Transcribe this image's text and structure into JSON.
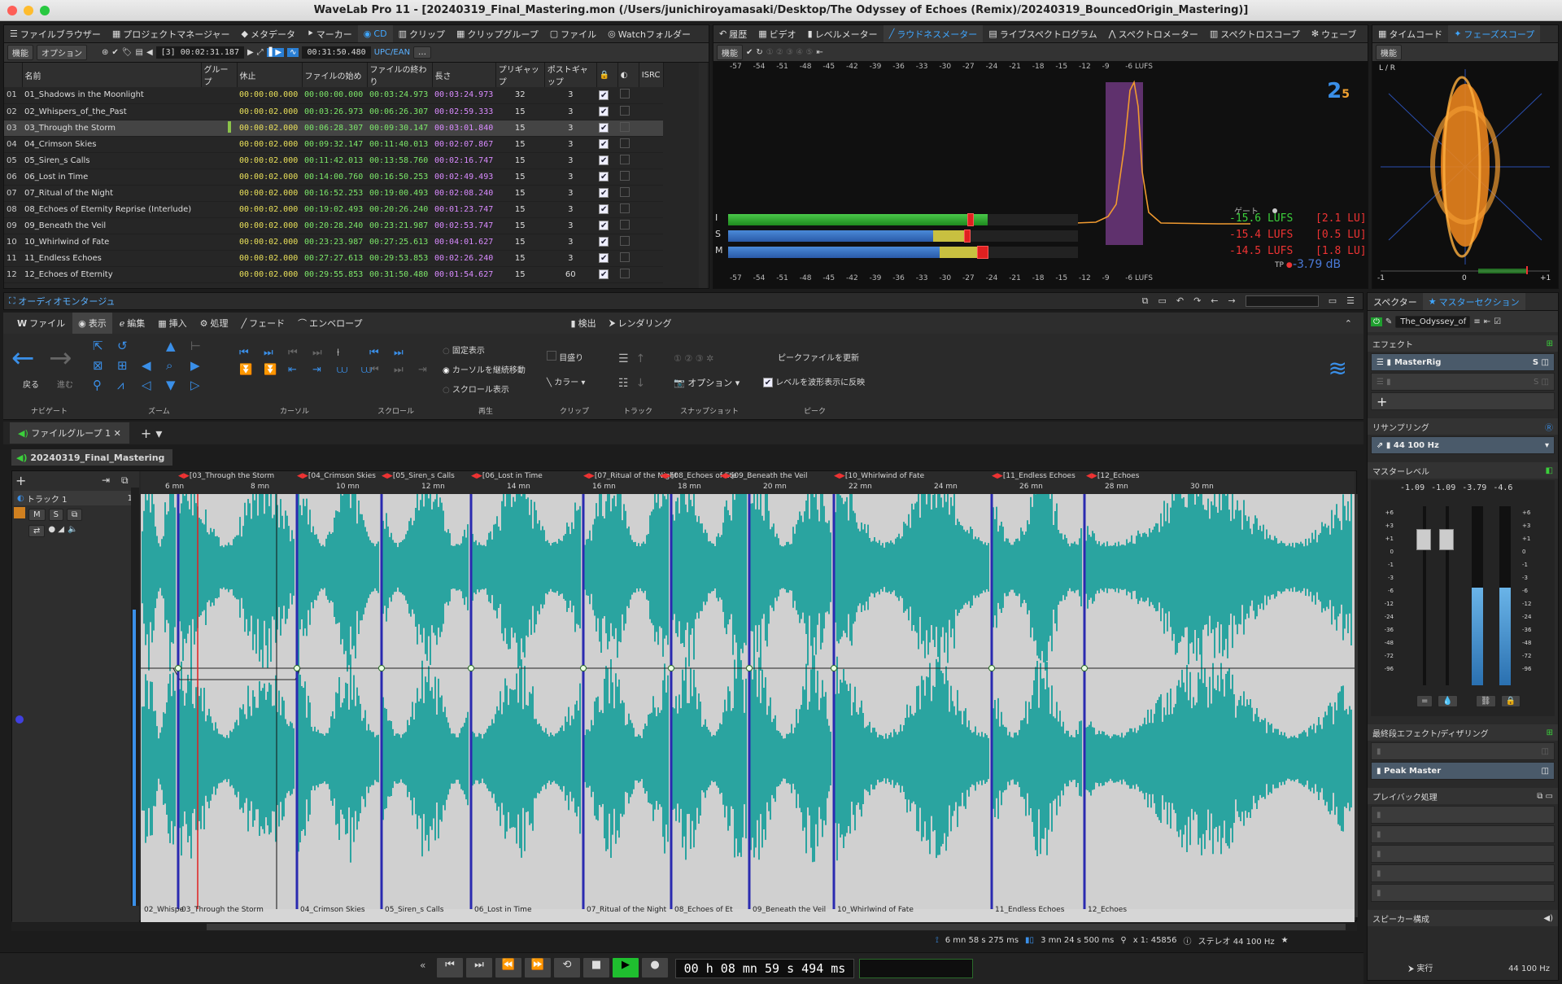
{
  "window": {
    "title": "WaveLab Pro 11 - [20240319_Final_Mastering.mon (/Users/junichiroyamasaki/Desktop/The Odyssey of Echoes (Remix)/20240319_BouncedOrigin_Mastering)]"
  },
  "top_left_tabs": [
    "ファイルブラウザー",
    "プロジェクトマネージャー",
    "メタデータ",
    "マーカー",
    "CD",
    "クリップ",
    "クリップグループ",
    "ファイル",
    "Watchフォルダー"
  ],
  "cd_toolbar": {
    "func": "機能",
    "option": "オプション",
    "track_pos": "[3] 00:02:31.187",
    "total": "00:31:50.480",
    "upc": "UPC/EAN"
  },
  "cd_columns": [
    "名前",
    "グループ",
    "休止",
    "ファイルの始め",
    "ファイルの終わり",
    "長さ",
    "プリギャップ",
    "ポストギャップ",
    "ISRC"
  ],
  "cd_tracks": [
    {
      "n": "01",
      "name": "01_Shadows in the Moonlight",
      "pause": "00:00:00.000",
      "start": "00:00:00.000",
      "end": "00:03:24.973",
      "len": "00:03:24.973",
      "pre": "32",
      "post": "3"
    },
    {
      "n": "02",
      "name": "02_Whispers_of_the_Past",
      "pause": "00:00:02.000",
      "start": "00:03:26.973",
      "end": "00:06:26.307",
      "len": "00:02:59.333",
      "pre": "15",
      "post": "3"
    },
    {
      "n": "03",
      "name": "03_Through the Storm",
      "pause": "00:00:02.000",
      "start": "00:06:28.307",
      "end": "00:09:30.147",
      "len": "00:03:01.840",
      "pre": "15",
      "post": "3"
    },
    {
      "n": "04",
      "name": "04_Crimson Skies",
      "pause": "00:00:02.000",
      "start": "00:09:32.147",
      "end": "00:11:40.013",
      "len": "00:02:07.867",
      "pre": "15",
      "post": "3"
    },
    {
      "n": "05",
      "name": "05_Siren_s Calls",
      "pause": "00:00:02.000",
      "start": "00:11:42.013",
      "end": "00:13:58.760",
      "len": "00:02:16.747",
      "pre": "15",
      "post": "3"
    },
    {
      "n": "06",
      "name": "06_Lost in Time",
      "pause": "00:00:02.000",
      "start": "00:14:00.760",
      "end": "00:16:50.253",
      "len": "00:02:49.493",
      "pre": "15",
      "post": "3"
    },
    {
      "n": "07",
      "name": "07_Ritual of the Night",
      "pause": "00:00:02.000",
      "start": "00:16:52.253",
      "end": "00:19:00.493",
      "len": "00:02:08.240",
      "pre": "15",
      "post": "3"
    },
    {
      "n": "08",
      "name": "08_Echoes of Eternity Reprise (Interlude)",
      "pause": "00:00:02.000",
      "start": "00:19:02.493",
      "end": "00:20:26.240",
      "len": "00:01:23.747",
      "pre": "15",
      "post": "3"
    },
    {
      "n": "09",
      "name": "09_Beneath the Veil",
      "pause": "00:00:02.000",
      "start": "00:20:28.240",
      "end": "00:23:21.987",
      "len": "00:02:53.747",
      "pre": "15",
      "post": "3"
    },
    {
      "n": "10",
      "name": "10_Whirlwind of Fate",
      "pause": "00:00:02.000",
      "start": "00:23:23.987",
      "end": "00:27:25.613",
      "len": "00:04:01.627",
      "pre": "15",
      "post": "3"
    },
    {
      "n": "11",
      "name": "11_Endless Echoes",
      "pause": "00:00:02.000",
      "start": "00:27:27.613",
      "end": "00:29:53.853",
      "len": "00:02:26.240",
      "pre": "15",
      "post": "3"
    },
    {
      "n": "12",
      "name": "12_Echoes of Eternity",
      "pause": "00:00:02.000",
      "start": "00:29:55.853",
      "end": "00:31:50.480",
      "len": "00:01:54.627",
      "pre": "15",
      "post": "60"
    }
  ],
  "meter_tabs": [
    "履歴",
    "ビデオ",
    "レベルメーター",
    "ラウドネスメーター",
    "ライブスペクトログラム",
    "スペクトロメーター",
    "スペクトロスコープ",
    "ウェーブ"
  ],
  "phase_tabs": [
    "タイムコード",
    "フェーズスコープ"
  ],
  "loudness": {
    "scale": [
      "-57",
      "-54",
      "-51",
      "-48",
      "-45",
      "-42",
      "-39",
      "-36",
      "-33",
      "-30",
      "-27",
      "-24",
      "-21",
      "-18",
      "-15",
      "-12",
      "-9",
      "-6 LUFS"
    ],
    "gate": "ゲート",
    "rows": [
      {
        "label": "I",
        "value": "-15.6 LUFS",
        "lu": "[2.1 LU]",
        "fill": 0.7
      },
      {
        "label": "S",
        "value": "-15.4 LUFS",
        "lu": "[0.5 LU]",
        "fill": 0.69
      },
      {
        "label": "M",
        "value": "-14.5 LUFS",
        "lu": "[1.8 LU]",
        "fill": 0.71
      }
    ],
    "tp": "TP",
    "tp_value": "-3.79 dB",
    "func": "機能"
  },
  "phase": {
    "label": "L / R",
    "func": "機能",
    "scale": [
      "-1",
      "0",
      "+1"
    ]
  },
  "montage": {
    "panel_title": "オーディオモンタージュ",
    "menu": [
      "ファイル",
      "表示",
      "編集",
      "挿入",
      "処理",
      "フェード",
      "エンベロープ"
    ],
    "menu_right": [
      "検出",
      "レンダリング"
    ],
    "nav": {
      "back": "戻る",
      "forward": "進む"
    },
    "groups": [
      "ナビゲート",
      "ズーム",
      "カーソル",
      "スクロール",
      "再生",
      "クリップ",
      "トラック",
      "スナップショット",
      "ピーク"
    ],
    "play_opts": [
      "固定表示",
      "カーソルを継続移動",
      "スクロール表示"
    ],
    "clip_opts": {
      "ruler": "目盛り",
      "color": "カラー"
    },
    "snap_option": "オプション",
    "peak": {
      "update": "ピークファイルを更新",
      "reflect": "レベルを波形表示に反映"
    },
    "file_group": "ファイルグループ 1",
    "doc_tab": "20240319_Final_Mastering",
    "track_name": "トラック 1",
    "track_num": "1",
    "mute": "M",
    "solo": "S",
    "ruler": [
      "6 mn",
      "8 mn",
      "10 mn",
      "12 mn",
      "14 mn",
      "16 mn",
      "18 mn",
      "20 mn",
      "22 mn",
      "24 mn",
      "26 mn",
      "28 mn",
      "30 mn"
    ],
    "markers_top": [
      "[03_Through the Storm",
      "[04_Crimson Skies",
      "[05_Siren_s Calls",
      "[06_Lost in Time",
      "[07_Ritual of the Night",
      "[08_Echoes of Ete",
      "[09_Beneath the Veil",
      "[10_Whirlwind of Fate",
      "[11_Endless Echoes",
      "[12_Echoes"
    ],
    "clips_bottom": [
      "02_Whispe",
      "03_Through the Storm",
      "04_Crimson Skies",
      "05_Siren_s Calls",
      "06_Lost in Time",
      "07_Ritual of the Night",
      "08_Echoes of Et",
      "09_Beneath the Veil",
      "10_Whirlwind of Fate",
      "11_Endless Echoes",
      "12_Echoes"
    ],
    "status": {
      "cursor": "6 mn 58 s 275 ms",
      "length": "3 mn 24 s 500 ms",
      "zoom": "x 1: 45856",
      "format": "ステレオ 44 100 Hz"
    }
  },
  "transport": {
    "time": "00 h 08 mn 59 s 494 ms"
  },
  "master": {
    "tabs": [
      "スペクター",
      "マスターセクション"
    ],
    "preset": "The_Odyssey_of",
    "effects": "エフェクト",
    "plugin": "MasterRig",
    "resampling": "リサンプリング",
    "rate": "44 100 Hz",
    "level": "マスターレベル",
    "level_values": [
      "-1.09",
      "-1.09",
      "-3.79",
      "-4.6"
    ],
    "scale": [
      "+6",
      "+3",
      "+1",
      "0",
      "-1",
      "-3",
      "-6",
      "-12",
      "-24",
      "-36",
      "-48",
      "-72",
      "-96"
    ],
    "final": "最終段エフェクト/ディザリング",
    "peak_master": "Peak Master",
    "playback": "プレイバック処理",
    "speaker": "スピーカー構成",
    "run": "実行",
    "status_rate": "44 100 Hz"
  }
}
